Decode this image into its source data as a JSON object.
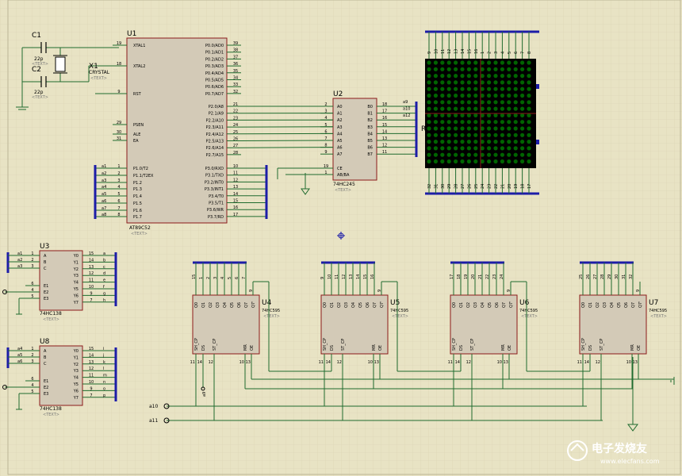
{
  "components": {
    "c1": {
      "ref": "C1",
      "value": "22p",
      "text": "<TEXT>"
    },
    "c2": {
      "ref": "C2",
      "value": "22p",
      "text": "<TEXT>"
    },
    "x1": {
      "ref": "X1",
      "type": "CRYSTAL",
      "text": "<TEXT>"
    },
    "u1": {
      "ref": "U1",
      "part": "AT89C52",
      "text": "<TEXT>",
      "left_pins": [
        {
          "num": "19",
          "name": "XTAL1"
        },
        {
          "num": "18",
          "name": "XTAL2"
        },
        {
          "num": "9",
          "name": "RST"
        },
        {
          "num": "29",
          "name": "PSEN"
        },
        {
          "num": "30",
          "name": "ALE"
        },
        {
          "num": "31",
          "name": "EA"
        },
        {
          "num": "1",
          "name": "P1.0/T2"
        },
        {
          "num": "2",
          "name": "P1.1/T2EX"
        },
        {
          "num": "3",
          "name": "P1.2"
        },
        {
          "num": "4",
          "name": "P1.3"
        },
        {
          "num": "5",
          "name": "P1.4"
        },
        {
          "num": "6",
          "name": "P1.5"
        },
        {
          "num": "7",
          "name": "P1.6"
        },
        {
          "num": "8",
          "name": "P1.7"
        }
      ],
      "p1_nets": [
        "a1",
        "a2",
        "a3",
        "a4",
        "a5",
        "a6",
        "a7",
        "a8"
      ],
      "p0_pins": [
        {
          "num": "39",
          "name": "P0.0/AD0"
        },
        {
          "num": "38",
          "name": "P0.1/AD1"
        },
        {
          "num": "37",
          "name": "P0.2/AD2"
        },
        {
          "num": "36",
          "name": "P0.3/AD3"
        },
        {
          "num": "35",
          "name": "P0.4/AD4"
        },
        {
          "num": "34",
          "name": "P0.5/AD5"
        },
        {
          "num": "33",
          "name": "P0.6/AD6"
        },
        {
          "num": "32",
          "name": "P0.7/AD7"
        }
      ],
      "p2_pins": [
        {
          "num": "21",
          "name": "P2.0/A8"
        },
        {
          "num": "22",
          "name": "P2.1/A9"
        },
        {
          "num": "23",
          "name": "P2.2/A10"
        },
        {
          "num": "24",
          "name": "P2.3/A11"
        },
        {
          "num": "25",
          "name": "P2.4/A12"
        },
        {
          "num": "26",
          "name": "P2.5/A13"
        },
        {
          "num": "27",
          "name": "P2.6/A14"
        },
        {
          "num": "28",
          "name": "P2.7/A15"
        }
      ],
      "p3_pins": [
        {
          "num": "10",
          "name": "P3.0/RXD"
        },
        {
          "num": "11",
          "name": "P3.1/TXD"
        },
        {
          "num": "12",
          "name": "P3.2/INT0"
        },
        {
          "num": "13",
          "name": "P3.3/INT1"
        },
        {
          "num": "14",
          "name": "P3.4/T0"
        },
        {
          "num": "15",
          "name": "P3.5/T1"
        },
        {
          "num": "16",
          "name": "P3.6/WR"
        },
        {
          "num": "17",
          "name": "P3.7/RD"
        }
      ]
    },
    "u2": {
      "ref": "U2",
      "part": "74HC245",
      "text": "<TEXT>",
      "a_pins": [
        {
          "num": "2",
          "name": "A0"
        },
        {
          "num": "3",
          "name": "A1"
        },
        {
          "num": "4",
          "name": "A2"
        },
        {
          "num": "5",
          "name": "A3"
        },
        {
          "num": "6",
          "name": "A4"
        },
        {
          "num": "7",
          "name": "A5"
        },
        {
          "num": "8",
          "name": "A6"
        },
        {
          "num": "9",
          "name": "A7"
        }
      ],
      "b_pins": [
        {
          "num": "18",
          "name": "B0"
        },
        {
          "num": "17",
          "name": "B1"
        },
        {
          "num": "16",
          "name": "B2"
        },
        {
          "num": "15",
          "name": "B3"
        },
        {
          "num": "14",
          "name": "B4"
        },
        {
          "num": "13",
          "name": "B5"
        },
        {
          "num": "12",
          "name": "B6"
        },
        {
          "num": "11",
          "name": "B7"
        }
      ],
      "ctrl_pins": [
        {
          "num": "19",
          "name": "CE"
        },
        {
          "num": "1",
          "name": "AB/BA"
        }
      ],
      "b_nets": [
        "a9",
        "a10",
        "a12"
      ]
    },
    "matrix": {
      "label": "R",
      "top_pins": [
        "9",
        "10",
        "11",
        "12",
        "13",
        "14",
        "15",
        "16",
        "1",
        "2",
        "3",
        "4",
        "5",
        "6",
        "7",
        "8"
      ],
      "bottom_pins": [
        "32",
        "31",
        "30",
        "29",
        "28",
        "27",
        "26",
        "25",
        "24",
        "23",
        "22",
        "21",
        "20",
        "19",
        "18",
        "17"
      ]
    },
    "u3": {
      "ref": "U3",
      "part": "74HC138",
      "text": "<TEXT>",
      "in_nets": [
        "a1",
        "a2",
        "a3"
      ],
      "left_pins": [
        {
          "num": "1",
          "name": "A"
        },
        {
          "num": "2",
          "name": "B"
        },
        {
          "num": "3",
          "name": "C"
        },
        {
          "num": "6",
          "name": "E1"
        },
        {
          "num": "4",
          "name": "E2"
        },
        {
          "num": "5",
          "name": "E3"
        }
      ],
      "right_pins": [
        {
          "num": "15",
          "name": "Y0"
        },
        {
          "num": "14",
          "name": "Y1"
        },
        {
          "num": "13",
          "name": "Y2"
        },
        {
          "num": "12",
          "name": "Y3"
        },
        {
          "num": "11",
          "name": "Y4"
        },
        {
          "num": "10",
          "name": "Y5"
        },
        {
          "num": "9",
          "name": "Y6"
        },
        {
          "num": "7",
          "name": "Y7"
        }
      ],
      "out_nets": [
        "a",
        "b",
        "c",
        "d",
        "e",
        "f",
        "g",
        "h"
      ]
    },
    "u8": {
      "ref": "U8",
      "part": "74HC138",
      "text": "<TEXT>",
      "in_nets": [
        "a4",
        "a5",
        "a6"
      ],
      "left_pins": [
        {
          "num": "1",
          "name": "A"
        },
        {
          "num": "2",
          "name": "B"
        },
        {
          "num": "3",
          "name": "C"
        },
        {
          "num": "6",
          "name": "E1"
        },
        {
          "num": "4",
          "name": "E2"
        },
        {
          "num": "5",
          "name": "E3"
        }
      ],
      "right_pins": [
        {
          "num": "15",
          "name": "Y0"
        },
        {
          "num": "14",
          "name": "Y1"
        },
        {
          "num": "13",
          "name": "Y2"
        },
        {
          "num": "12",
          "name": "Y3"
        },
        {
          "num": "11",
          "name": "Y4"
        },
        {
          "num": "10",
          "name": "Y5"
        },
        {
          "num": "9",
          "name": "Y6"
        },
        {
          "num": "7",
          "name": "Y7"
        }
      ],
      "out_nets": [
        "i",
        "j",
        "k",
        "l",
        "m",
        "n",
        "o",
        "p"
      ]
    },
    "shift_registers": [
      {
        "ref": "U4",
        "part": "74HC595",
        "text": "<TEXT>",
        "top_pins": [
          "15",
          "1",
          "2",
          "3",
          "4",
          "5",
          "6",
          "7"
        ],
        "serial_out": "9"
      },
      {
        "ref": "U5",
        "part": "74HC595",
        "text": "<TEXT>",
        "top_pins": [
          "9",
          "10",
          "11",
          "12",
          "13",
          "14",
          "15",
          "16"
        ],
        "serial_out": "9"
      },
      {
        "ref": "U6",
        "part": "74HC595",
        "text": "<TEXT>",
        "top_pins": [
          "17",
          "18",
          "19",
          "20",
          "21",
          "22",
          "23",
          "24"
        ],
        "serial_out": "9"
      },
      {
        "ref": "U7",
        "part": "74HC595",
        "text": "<TEXT>",
        "top_pins": [
          "25",
          "26",
          "27",
          "28",
          "29",
          "30",
          "31",
          "32"
        ],
        "serial_out": "9"
      }
    ],
    "sr_outputs": [
      "Q0",
      "Q1",
      "Q2",
      "Q3",
      "Q4",
      "Q5",
      "Q6",
      "Q7",
      "Q7'"
    ],
    "sr_bottom_labels": [
      "SH_CP",
      "DS",
      "ST_CP",
      "MR",
      "OE"
    ],
    "sr_bottom_pins": [
      "11",
      "14",
      "12",
      "10",
      "13"
    ],
    "u4_ds_net": "a9",
    "terminals": [
      {
        "name": "a10"
      },
      {
        "name": "a11"
      }
    ]
  },
  "watermark": {
    "text": "电子发烧友",
    "url": "www.elecfans.com"
  },
  "colors": {
    "background": "#e8e3c4",
    "chip_fill": "#d3cab7",
    "chip_stroke": "#8b1a1a",
    "wire": "#1f6b2e",
    "bus": "#1c1ca8",
    "led": "#006400",
    "led_bg": "#000000"
  }
}
